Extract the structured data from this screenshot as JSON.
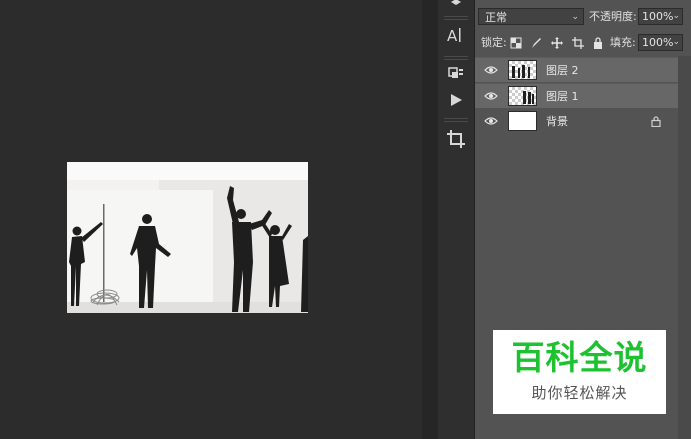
{
  "layers_panel": {
    "blend_mode": "正常",
    "opacity_label": "不透明度:",
    "opacity_value": "100%",
    "lock_label": "锁定:",
    "fill_label": "填充:",
    "fill_value": "100%",
    "lock_icons": [
      "lock-transparent-pixels-icon",
      "lock-image-pixels-icon",
      "lock-position-icon",
      "lock-artboard-icon",
      "lock-all-icon"
    ],
    "layers": [
      {
        "name": "图层 2",
        "visible": true,
        "selected": true,
        "thumbnail": "transparent-with-figures"
      },
      {
        "name": "图层 1",
        "visible": true,
        "selected": true,
        "thumbnail": "transparent-with-figures"
      },
      {
        "name": "背景",
        "visible": true,
        "selected": false,
        "locked": true,
        "thumbnail": "white"
      }
    ]
  },
  "toolstrip": {
    "tools": [
      "3d-icon",
      "character-text-icon",
      "layer-comps-icon",
      "play-action-icon",
      "crop-icon"
    ]
  },
  "document": {
    "content": "photo of business people silhouettes celebrating"
  },
  "watermark": {
    "title": "百科全说",
    "subtitle": "助你轻松解决",
    "title_color": "#1ec231"
  }
}
